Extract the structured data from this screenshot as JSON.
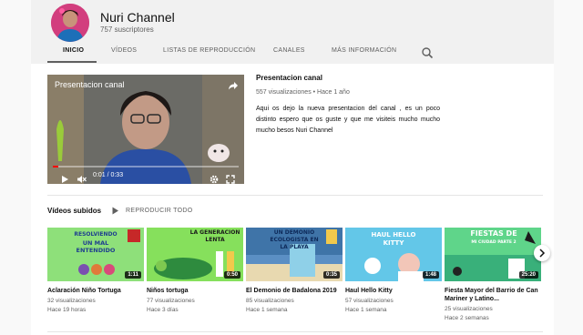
{
  "channel": {
    "name": "Nuri Channel",
    "subscribers": "757 suscriptores"
  },
  "tabs": [
    {
      "label": "INICIO",
      "active": true
    },
    {
      "label": "VÍDEOS",
      "active": false
    },
    {
      "label": "LISTAS DE REPRODUCCIÓN",
      "active": false
    },
    {
      "label": "CANALES",
      "active": false
    },
    {
      "label": "MÁS INFORMACIÓN",
      "active": false
    }
  ],
  "featured": {
    "player_title": "Presentacion canal",
    "time": "0:01 / 0:33",
    "progress_fraction": 0.03,
    "title": "Presentacion canal",
    "meta": "557 visualizaciones • Hace 1 año",
    "description": "Aqui os dejo la nueva presentacion del canal , es un poco distinto espero que os guste y que me visiteis mucho mucho mucho besos Nuri Channel"
  },
  "uploads": {
    "title": "Vídeos subidos",
    "play_all": "REPRODUCIR TODO",
    "videos": [
      {
        "title": "Aclaración Niño Tortuga",
        "views": "32 visualizaciones",
        "age": "Hace 19 horas",
        "duration": "1:11",
        "thumb_bg": "#8ee07a",
        "thumb_text": [
          "RESOLVIENDO",
          "UN MAL",
          "ENTENDIDO"
        ],
        "thumb_text_color": "#1f3f8f"
      },
      {
        "title": "Niños tortuga",
        "views": "77 visualizaciones",
        "age": "Hace 3 días",
        "duration": "0:50",
        "thumb_bg": "#86e05c",
        "thumb_text": [
          "LA GENERACION",
          "LENTA"
        ],
        "thumb_text_color": "#1b1b1b"
      },
      {
        "title": "El Demonio de Badalona 2019",
        "views": "85 visualizaciones",
        "age": "Hace 1 semana",
        "duration": "0:35",
        "thumb_bg": "#3f74a8",
        "thumb_text": [
          "UN DEMONIO",
          "ECOLOGISTA EN",
          "LA PLAYA"
        ],
        "thumb_text_color": "#0e2a5a"
      },
      {
        "title": "Haul Hello Kitty",
        "views": "57 visualizaciones",
        "age": "Hace 1 semana",
        "duration": "1:48",
        "thumb_bg": "#63c7e8",
        "thumb_text": [
          "HAUL HELLO",
          "KITTY"
        ],
        "thumb_text_color": "#ffffff"
      },
      {
        "title": "Fiesta Mayor del Barrio de Can Mariner y Latino...",
        "views": "25 visualizaciones",
        "age": "Hace 2 semanas",
        "duration": "25:20",
        "thumb_bg": "#5fd58a",
        "thumb_text": [
          "FIESTAS DE",
          "MI CIUDAD PARTE 2"
        ],
        "thumb_text_color": "#ffffff"
      }
    ]
  },
  "icons": {
    "search": "search-icon",
    "share": "share-icon",
    "play": "play-icon",
    "mute": "mute-icon",
    "settings": "gear-icon",
    "fullscreen": "fullscreen-icon",
    "next": "chevron-right-icon"
  }
}
